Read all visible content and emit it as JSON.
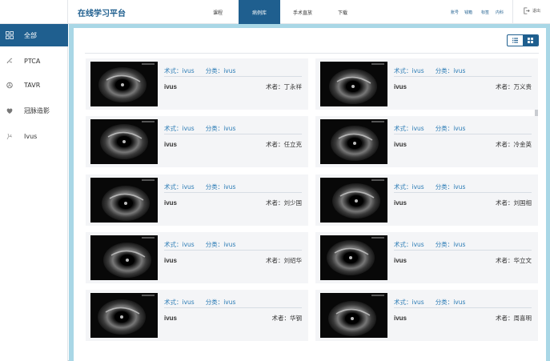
{
  "header": {
    "brand": "在线学习平台",
    "nav": [
      {
        "label": "课程",
        "active": false
      },
      {
        "label": "病例库",
        "active": true
      },
      {
        "label": "手术直放",
        "active": false
      },
      {
        "label": "下载",
        "active": false
      }
    ],
    "utils": [
      "账号",
      "钱箱",
      "标签",
      "内科"
    ],
    "logout": "退出"
  },
  "sidebar": {
    "items": [
      {
        "label": "全部",
        "icon": "grid-icon",
        "active": true
      },
      {
        "label": "PTCA",
        "icon": "artery-icon",
        "active": false
      },
      {
        "label": "TAVR",
        "icon": "valve-icon",
        "active": false
      },
      {
        "label": "冠脉造影",
        "icon": "heart-icon",
        "active": false
      },
      {
        "label": "Ivus",
        "icon": "vessel-icon",
        "active": false
      }
    ]
  },
  "toolbar": {
    "view_modes": [
      {
        "icon": "list-view-icon",
        "active": false
      },
      {
        "icon": "grid-view-icon",
        "active": true
      }
    ]
  },
  "cards": [
    {
      "technique_label": "术式：",
      "technique": "ivus",
      "category_label": "分类：",
      "category": "ivus",
      "title": "ivus",
      "author_label": "术者：",
      "author": "丁永祥"
    },
    {
      "technique_label": "术式：",
      "technique": "ivus",
      "category_label": "分类：",
      "category": "ivus",
      "title": "ivus",
      "author_label": "术者：",
      "author": "万义贵"
    },
    {
      "technique_label": "术式：",
      "technique": "ivus",
      "category_label": "分类：",
      "category": "ivus",
      "title": "ivus",
      "author_label": "术者：",
      "author": "任立克"
    },
    {
      "technique_label": "术式：",
      "technique": "ivus",
      "category_label": "分类：",
      "category": "ivus",
      "title": "ivus",
      "author_label": "术者：",
      "author": "冷金英"
    },
    {
      "technique_label": "术式：",
      "technique": "ivus",
      "category_label": "分类：",
      "category": "ivus",
      "title": "ivus",
      "author_label": "术者：",
      "author": "刘少国"
    },
    {
      "technique_label": "术式：",
      "technique": "ivus",
      "category_label": "分类：",
      "category": "ivus",
      "title": "ivus",
      "author_label": "术者：",
      "author": "刘国相"
    },
    {
      "technique_label": "术式：",
      "technique": "ivus",
      "category_label": "分类：",
      "category": "ivus",
      "title": "ivus",
      "author_label": "术者：",
      "author": "刘绍华"
    },
    {
      "technique_label": "术式：",
      "technique": "ivus",
      "category_label": "分类：",
      "category": "ivus",
      "title": "ivus",
      "author_label": "术者：",
      "author": "华立文"
    },
    {
      "technique_label": "术式：",
      "technique": "ivus",
      "category_label": "分类：",
      "category": "ivus",
      "title": "ivus",
      "author_label": "术者：",
      "author": "华钢"
    },
    {
      "technique_label": "术式：",
      "technique": "ivus",
      "category_label": "分类：",
      "category": "ivus",
      "title": "ivus",
      "author_label": "术者：",
      "author": "周喜明"
    }
  ],
  "colors": {
    "primary": "#1f5f8f",
    "link": "#2a7bb5",
    "background": "#a9d7e6",
    "card": "#f4f5f7"
  }
}
